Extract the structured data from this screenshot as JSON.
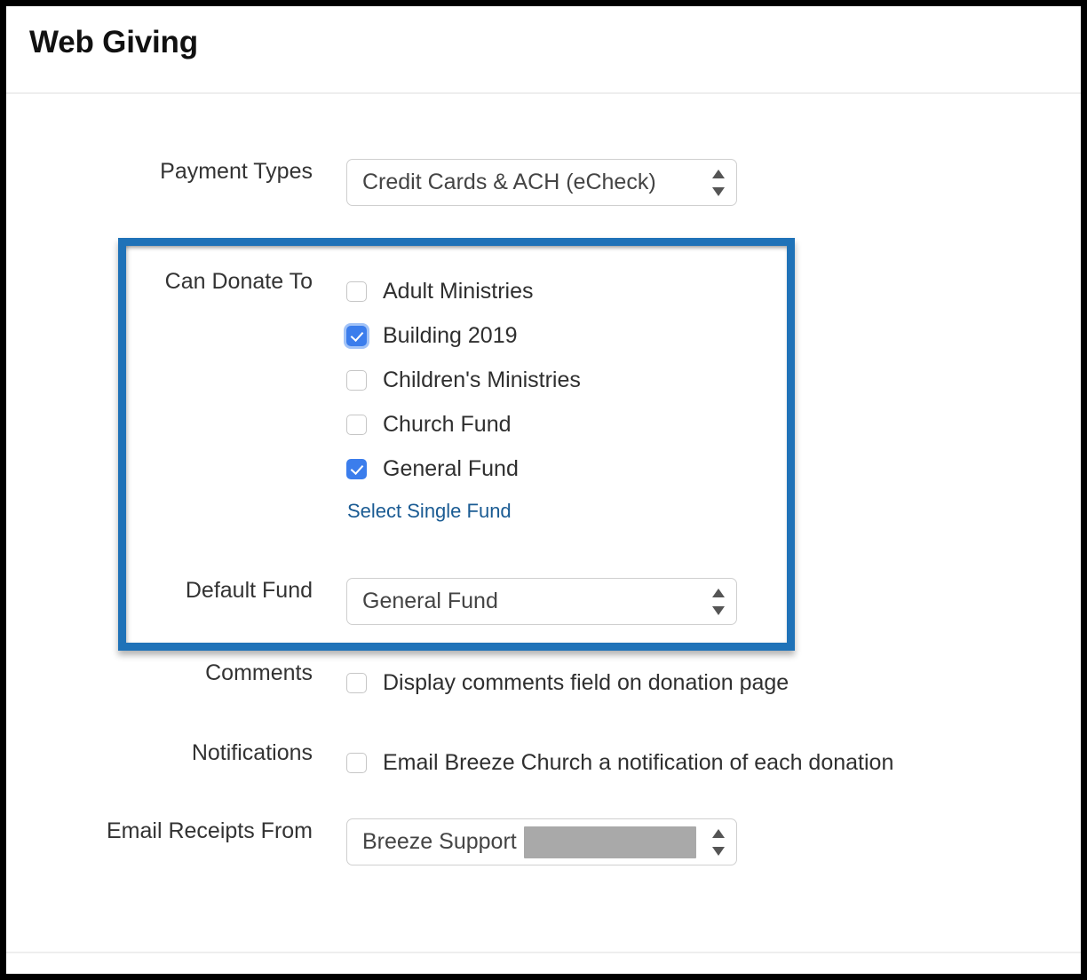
{
  "header": {
    "title": "Web Giving"
  },
  "form": {
    "payment_types": {
      "label": "Payment Types",
      "value": "Credit Cards & ACH (eCheck)"
    },
    "can_donate_to": {
      "label": "Can Donate To",
      "funds": [
        {
          "label": "Adult Ministries",
          "checked": false,
          "focused": false
        },
        {
          "label": "Building 2019",
          "checked": true,
          "focused": true
        },
        {
          "label": "Children's Ministries",
          "checked": false,
          "focused": false
        },
        {
          "label": "Church Fund",
          "checked": false,
          "focused": false
        },
        {
          "label": "General Fund",
          "checked": true,
          "focused": false
        }
      ],
      "select_single_fund_link": "Select Single Fund"
    },
    "default_fund": {
      "label": "Default Fund",
      "value": "General Fund"
    },
    "comments": {
      "label": "Comments",
      "checkbox_label": "Display comments field on donation page",
      "checked": false
    },
    "notifications": {
      "label": "Notifications",
      "checkbox_label": "Email Breeze Church a notification of each donation",
      "checked": false
    },
    "email_receipts_from": {
      "label": "Email Receipts From",
      "value": "Breeze Support",
      "redacted": true
    }
  },
  "colors": {
    "highlight_border": "#1f72b8",
    "checkbox_checked": "#3b7dec",
    "link": "#1a5b93"
  }
}
